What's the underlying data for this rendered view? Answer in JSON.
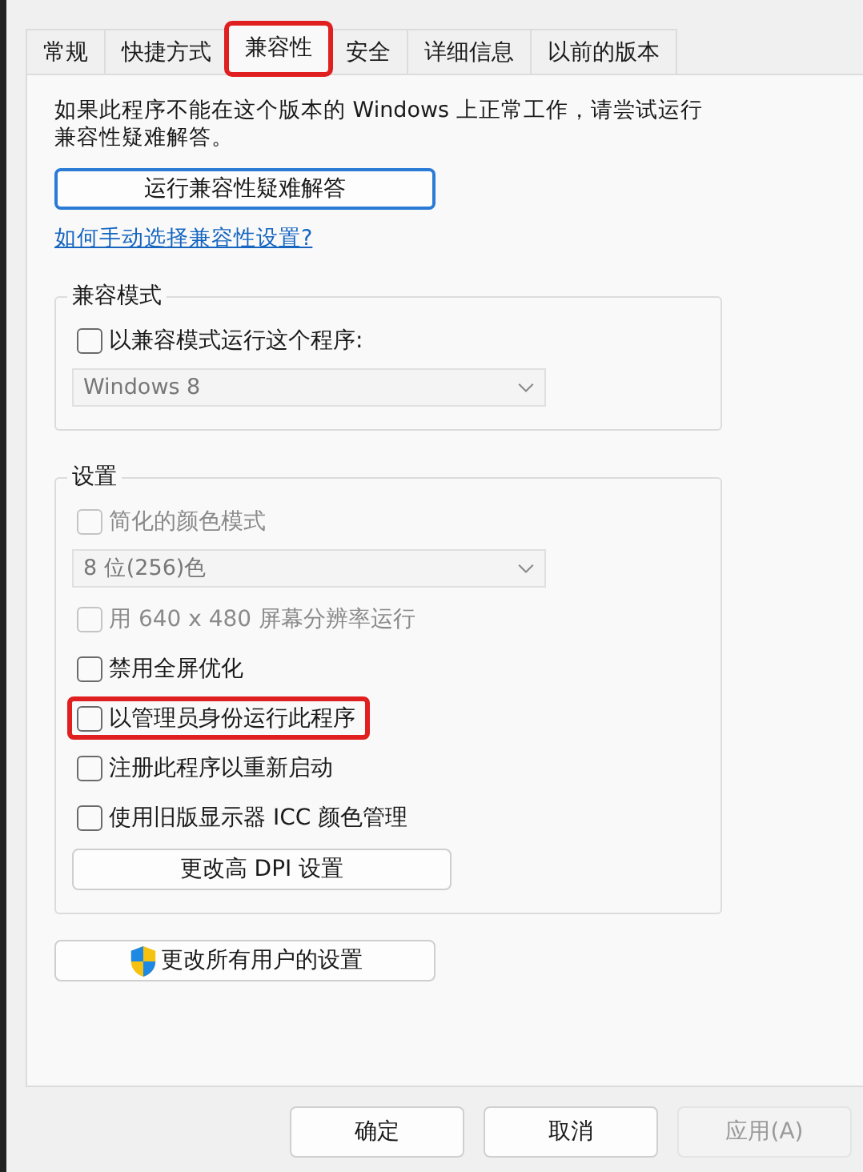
{
  "tabs": [
    {
      "label": "常规",
      "selected": false,
      "highlighted": false
    },
    {
      "label": "快捷方式",
      "selected": false,
      "highlighted": false
    },
    {
      "label": "兼容性",
      "selected": true,
      "highlighted": true
    },
    {
      "label": "安全",
      "selected": false,
      "highlighted": false
    },
    {
      "label": "详细信息",
      "selected": false,
      "highlighted": false
    },
    {
      "label": "以前的版本",
      "selected": false,
      "highlighted": false
    }
  ],
  "intro": "如果此程序不能在这个版本的 Windows 上正常工作，请尝试运行兼容性疑难解答。",
  "troubleshoot_button": "运行兼容性疑难解答",
  "help_link": "如何手动选择兼容性设置?",
  "groups": [
    {
      "title": "兼容模式",
      "items": [
        {
          "kind": "checkbox",
          "label": "以兼容模式运行这个程序:",
          "checked": false,
          "disabled": false,
          "highlighted": false
        },
        {
          "kind": "dropdown",
          "label": "Windows 8",
          "disabled": true
        }
      ]
    },
    {
      "title": "设置",
      "items": [
        {
          "kind": "checkbox",
          "label": "简化的颜色模式",
          "checked": false,
          "disabled": true,
          "highlighted": false
        },
        {
          "kind": "dropdown",
          "label": "8 位(256)色",
          "disabled": true
        },
        {
          "kind": "checkbox",
          "label": "用 640 x 480 屏幕分辨率运行",
          "checked": false,
          "disabled": true,
          "highlighted": false
        },
        {
          "kind": "checkbox",
          "label": "禁用全屏优化",
          "checked": false,
          "disabled": false,
          "highlighted": false
        },
        {
          "kind": "checkbox",
          "label": "以管理员身份运行此程序",
          "checked": false,
          "disabled": false,
          "highlighted": true
        },
        {
          "kind": "checkbox",
          "label": "注册此程序以重新启动",
          "checked": false,
          "disabled": false,
          "highlighted": false
        },
        {
          "kind": "checkbox",
          "label": "使用旧版显示器 ICC 颜色管理",
          "checked": false,
          "disabled": false,
          "highlighted": false
        },
        {
          "kind": "button",
          "label": "更改高 DPI 设置",
          "disabled": false
        }
      ]
    }
  ],
  "all_users_button": "更改所有用户的设置",
  "footer_buttons": [
    {
      "label": "确定",
      "disabled": false
    },
    {
      "label": "取消",
      "disabled": false
    },
    {
      "label": "应用(A)",
      "disabled": true
    }
  ]
}
